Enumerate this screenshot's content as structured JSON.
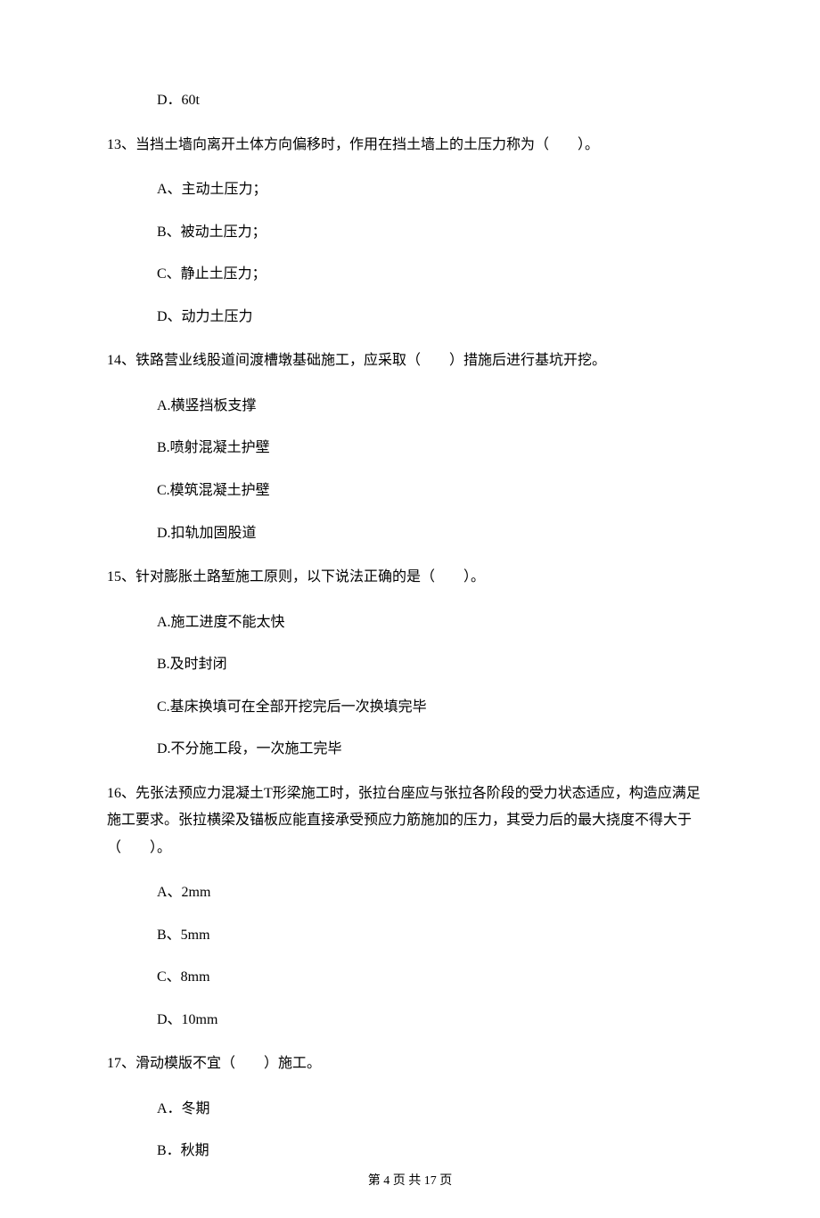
{
  "q12_option_d": "D．60t",
  "q13": {
    "stem": "13、当挡土墙向离开土体方向偏移时，作用在挡土墙上的土压力称为（　　）。",
    "a": "A、主动土压力；",
    "b": "B、被动土压力；",
    "c": "C、静止土压力；",
    "d": "D、动力土压力"
  },
  "q14": {
    "stem": "14、铁路营业线股道间渡槽墩基础施工，应采取（　　）措施后进行基坑开挖。",
    "a": "A.横竖挡板支撑",
    "b": "B.喷射混凝土护壁",
    "c": "C.模筑混凝土护壁",
    "d": "D.扣轨加固股道"
  },
  "q15": {
    "stem": "15、针对膨胀土路堑施工原则，以下说法正确的是（　　）。",
    "a": "A.施工进度不能太快",
    "b": "B.及时封闭",
    "c": "C.基床换填可在全部开挖完后一次换填完毕",
    "d": "D.不分施工段，一次施工完毕"
  },
  "q16": {
    "stem": "16、先张法预应力混凝土T形梁施工时，张拉台座应与张拉各阶段的受力状态适应，构造应满足施工要求。张拉横梁及锚板应能直接承受预应力筋施加的压力，其受力后的最大挠度不得大于（　　）。",
    "a": "A、2mm",
    "b": "B、5mm",
    "c": "C、8mm",
    "d": "D、10mm"
  },
  "q17": {
    "stem": "17、滑动模版不宜（　　）施工。",
    "a": "A．冬期",
    "b": "B．秋期"
  },
  "footer": "第 4 页 共 17 页"
}
